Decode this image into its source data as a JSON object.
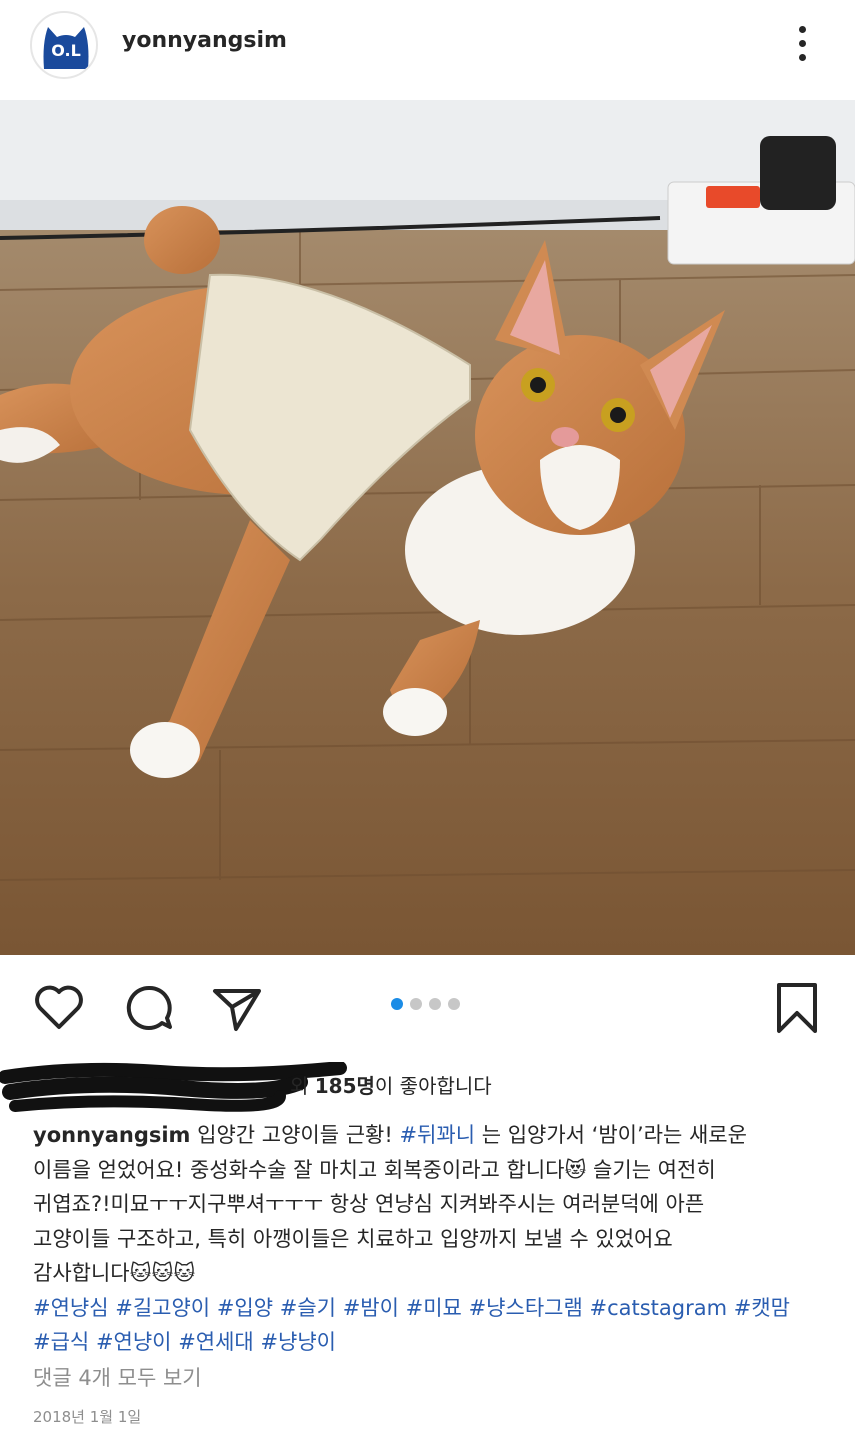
{
  "header": {
    "username": "yonnyangsim",
    "avatar_icon": "cat-logo-icon"
  },
  "photo": {
    "subject": "orange-white-cat-in-bandage-on-wood-floor"
  },
  "carousel": {
    "total": 4,
    "active_index": 0,
    "active_color": "#1b8ce6",
    "inactive_color": "#c7c7c7"
  },
  "likes": {
    "visible_suffix": "외",
    "count": "185명",
    "text_after": "이 좋아합니다"
  },
  "caption": {
    "username": "yonnyangsim",
    "line1": {
      "before": "입양간 고양이들 근황! ",
      "tag": "#뒤꽈니",
      "after": " 는 입양가서 ‘밤이’라는 새로운"
    },
    "line2": {
      "before": "이름을 얻었어요! 중성화수술 잘 마치고 회복중이라고 합니다",
      "after": " 슬기는 여전히"
    },
    "line3": "귀엽죠?!미묘ㅜㅜ지구뿌셔ㅜㅜㅜ 항상 연냥심 지켜봐주시는 여러분덕에 아픈",
    "line4": "고양이들 구조하고, 특히 아깽이들은 치료하고 입양까지 보낼 수 있었어요",
    "line5": "감사합니다",
    "emoji_heart_eyes": "😻",
    "emoji_cat": "🐱",
    "hashtags_line1": [
      "#연냥심",
      "#길고양이",
      "#입양",
      "#슬기",
      "#밤이",
      "#미묘",
      "#냥스타그램",
      "#catstagram",
      "#캣맘"
    ],
    "hashtags_line2": [
      "#급식",
      "#연냥이",
      "#연세대",
      "#냥냥이"
    ]
  },
  "comments_link": "댓글 4개 모두 보기",
  "post_date": "2018년 1월 1일"
}
